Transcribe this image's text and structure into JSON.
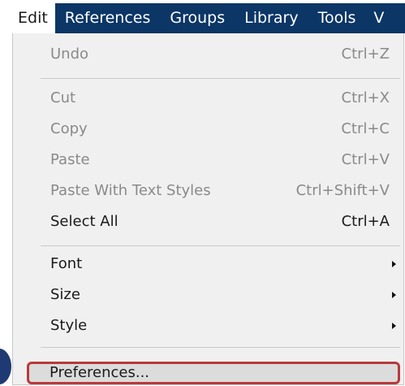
{
  "menubar": {
    "items": [
      {
        "label": "Edit"
      },
      {
        "label": "References"
      },
      {
        "label": "Groups"
      },
      {
        "label": "Library"
      },
      {
        "label": "Tools"
      },
      {
        "label": "V"
      }
    ]
  },
  "menu": {
    "undo": {
      "label": "Undo",
      "shortcut": "Ctrl+Z"
    },
    "cut": {
      "label": "Cut",
      "shortcut": "Ctrl+X"
    },
    "copy": {
      "label": "Copy",
      "shortcut": "Ctrl+C"
    },
    "paste": {
      "label": "Paste",
      "shortcut": "Ctrl+V"
    },
    "paste_styles": {
      "label": "Paste With Text Styles",
      "shortcut": "Ctrl+Shift+V"
    },
    "select_all": {
      "label": "Select All",
      "shortcut": "Ctrl+A"
    },
    "font": {
      "label": "Font"
    },
    "size": {
      "label": "Size"
    },
    "style": {
      "label": "Style"
    },
    "preferences": {
      "label": "Preferences..."
    }
  },
  "colors": {
    "menubar_bg": "#0b3666",
    "dropdown_bg": "#f0f0f0",
    "highlight_border": "#b83a3a",
    "callout": "#1f3a73"
  }
}
